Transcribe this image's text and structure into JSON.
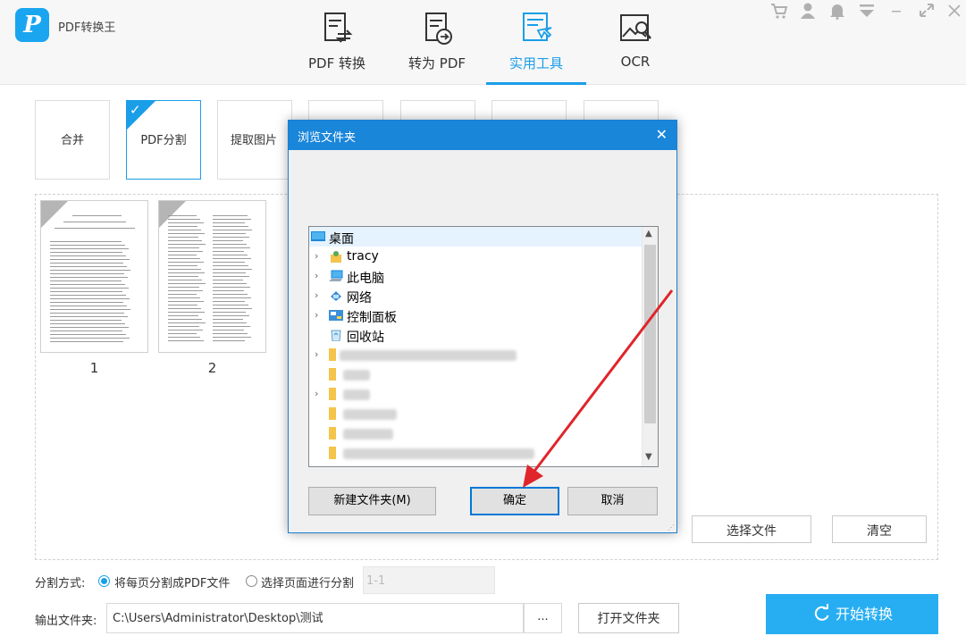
{
  "app": {
    "title": "PDF转换王",
    "logo_letter": "P"
  },
  "nav": {
    "tabs": [
      {
        "label": "PDF 转换",
        "icon": "pdf-convert-icon"
      },
      {
        "label": "转为 PDF",
        "icon": "to-pdf-icon"
      },
      {
        "label": "实用工具",
        "icon": "tools-icon",
        "active": true
      },
      {
        "label": "OCR",
        "icon": "ocr-icon"
      }
    ]
  },
  "window_controls": [
    "cart-icon",
    "user-icon",
    "bell-icon",
    "dropdown-icon",
    "minimize-icon",
    "maximize-icon",
    "close-icon"
  ],
  "tools": {
    "items": [
      {
        "label": "合并"
      },
      {
        "label": "PDF分割",
        "selected": true
      },
      {
        "label": "提取图片"
      }
    ]
  },
  "files": {
    "pages": [
      {
        "number": "1"
      },
      {
        "number": "2"
      }
    ],
    "select_file_label": "选择文件",
    "clear_label": "清空"
  },
  "split": {
    "label": "分割方式:",
    "option_each_page": "将每页分割成PDF文件",
    "option_select_pages": "选择页面进行分割",
    "page_range_placeholder": "1-1",
    "selected_option": "each_page"
  },
  "output": {
    "label": "输出文件夹:",
    "path": "C:\\Users\\Administrator\\Desktop\\测试",
    "browse_label": "...",
    "open_folder_label": "打开文件夹"
  },
  "start_button": {
    "label": "开始转换"
  },
  "dialog": {
    "title": "浏览文件夹",
    "tree": {
      "items": [
        {
          "label": "桌面",
          "icon": "desktop-icon",
          "selected": true
        },
        {
          "label": "tracy",
          "icon": "user-folder-icon"
        },
        {
          "label": "此电脑",
          "icon": "computer-icon"
        },
        {
          "label": "网络",
          "icon": "network-icon"
        },
        {
          "label": "控制面板",
          "icon": "control-panel-icon"
        },
        {
          "label": "回收站",
          "icon": "recycle-bin-icon"
        },
        {
          "label": "",
          "icon": "folder-icon",
          "blurred": true
        },
        {
          "label": "",
          "icon": "folder-icon",
          "blurred": true
        },
        {
          "label": "",
          "icon": "folder-icon",
          "blurred": true
        },
        {
          "label": "",
          "icon": "folder-icon",
          "blurred": true
        },
        {
          "label": "",
          "icon": "folder-icon",
          "blurred": true
        },
        {
          "label": "",
          "icon": "folder-icon",
          "blurred": true
        }
      ]
    },
    "new_folder_label": "新建文件夹(M)",
    "ok_label": "确定",
    "cancel_label": "取消"
  },
  "colors": {
    "accent": "#1a9ee8",
    "start_button": "#27aef2",
    "dialog_title": "#1a86da",
    "arrow": "#e0252b"
  }
}
